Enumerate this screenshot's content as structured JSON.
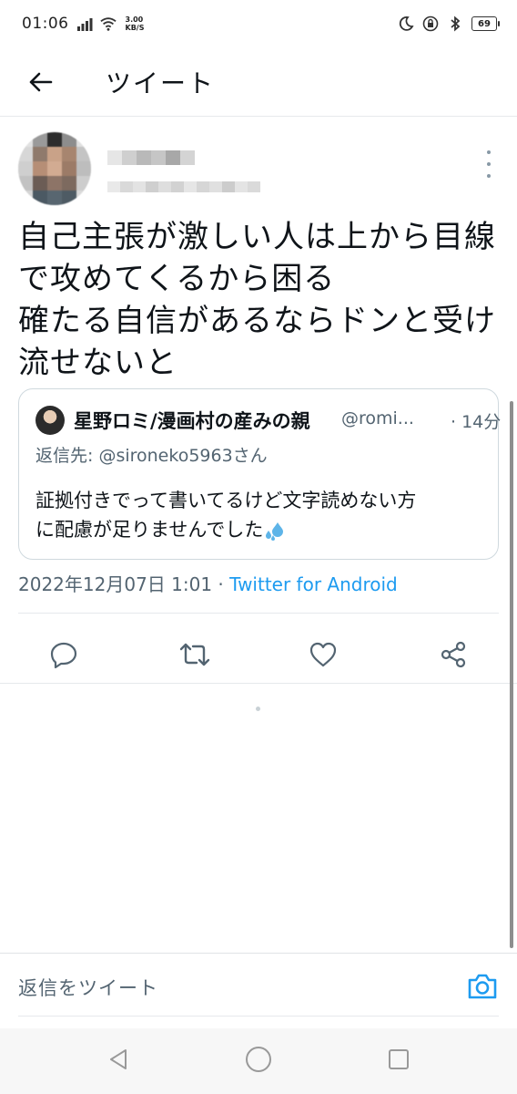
{
  "status_bar": {
    "time": "01:06",
    "speed_value": "3.00",
    "speed_unit": "KB/S",
    "battery": "69"
  },
  "header": {
    "title": "ツイート"
  },
  "tweet": {
    "text": "自己主張が激しい人は上から目線\nで攻めてくるから困る\n確たる自信があるならドンと受け\n流せないと",
    "timestamp": "2022年12月07日 1:01",
    "separator": " · ",
    "source": "Twitter for Android"
  },
  "quoted": {
    "author_name": "星野ロミ/漫画村の産みの親",
    "author_handle": "@romi...",
    "time": "· 14分",
    "reply_to": "返信先: @sironeko5963さん",
    "text": "証拠付きでって書いてるけど文字読めない方\nに配慮が足りませんでした"
  },
  "reply": {
    "placeholder": "返信をツイート"
  },
  "colors": {
    "accent": "#1d9bf0",
    "muted": "#536471",
    "border": "#cfd9de"
  }
}
